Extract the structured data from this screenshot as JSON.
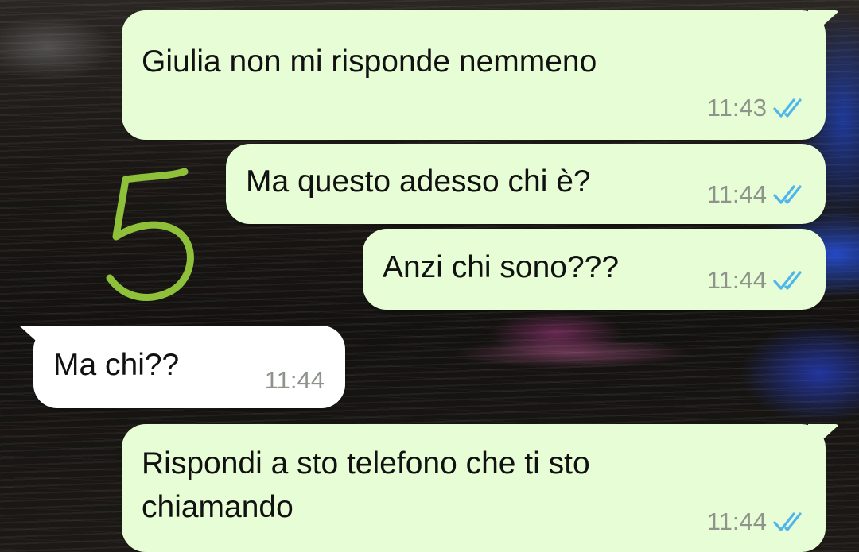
{
  "messages": [
    {
      "direction": "outgoing",
      "text": "Giulia non mi risponde nemmeno",
      "time": "11:43",
      "status": "read"
    },
    {
      "direction": "outgoing",
      "text": "Ma questo adesso chi è?",
      "time": "11:44",
      "status": "read"
    },
    {
      "direction": "outgoing",
      "text": "Anzi chi sono???",
      "time": "11:44",
      "status": "read"
    },
    {
      "direction": "incoming",
      "text": "Ma chi??",
      "time": "11:44"
    },
    {
      "direction": "outgoing",
      "text_line1": "Rispondi a sto telefono che ti sto",
      "text_line2": "chiamando",
      "time": "11:44",
      "status": "read"
    }
  ],
  "annotation": {
    "label": "5",
    "color": "#8fc03a"
  },
  "colors": {
    "outgoing_bubble": "#e7fdd5",
    "incoming_bubble": "#ffffff",
    "read_ticks": "#4fb6ec",
    "timestamp": "#8e948b"
  },
  "icons": {
    "read_status": "double-check-icon"
  }
}
